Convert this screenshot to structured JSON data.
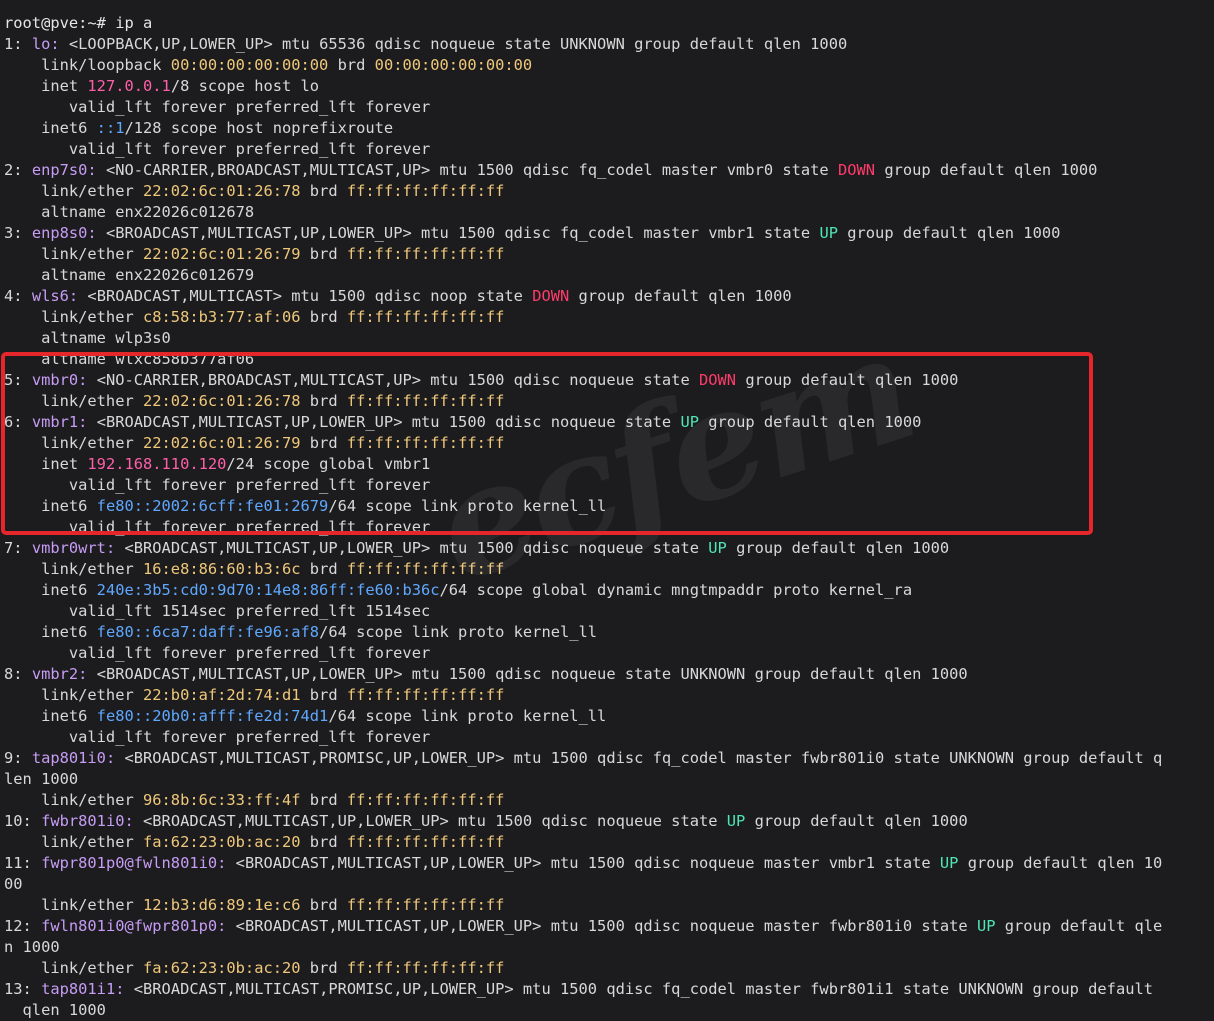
{
  "colors": {
    "background": "#1c1c1e",
    "text": "#d8d8d8",
    "interface": "#c79cf5",
    "mac": "#f0c87a",
    "ipv4": "#ff5fa8",
    "ipv6": "#5fa8ff",
    "state_down": "#ff3b6b",
    "state_up": "#4fe6b5",
    "highlight_box": "#e5262b"
  },
  "watermark": "ecfem",
  "terminal_lines": [
    [
      {
        "t": "                                                                   ",
        "c": "default"
      }
    ],
    [
      {
        "t": "root@pve:~# ip a",
        "c": "prompt"
      }
    ],
    [
      {
        "t": "1: ",
        "c": "default"
      },
      {
        "t": "lo:",
        "c": "iface"
      },
      {
        "t": " <LOOPBACK,UP,LOWER_UP> mtu 65536 qdisc noqueue state UNKNOWN group default qlen 1000",
        "c": "default"
      }
    ],
    [
      {
        "t": "    link/loopback ",
        "c": "default"
      },
      {
        "t": "00:00:00:00:00:00",
        "c": "mac"
      },
      {
        "t": " brd ",
        "c": "default"
      },
      {
        "t": "00:00:00:00:00:00",
        "c": "bcast"
      }
    ],
    [
      {
        "t": "    inet ",
        "c": "default"
      },
      {
        "t": "127.0.0.1",
        "c": "ip4"
      },
      {
        "t": "/8 scope host lo",
        "c": "default"
      }
    ],
    [
      {
        "t": "       valid_lft forever preferred_lft forever",
        "c": "default"
      }
    ],
    [
      {
        "t": "    inet6 ",
        "c": "default"
      },
      {
        "t": "::1",
        "c": "ip6"
      },
      {
        "t": "/128 scope host noprefixroute",
        "c": "default"
      }
    ],
    [
      {
        "t": "       valid_lft forever preferred_lft forever",
        "c": "default"
      }
    ],
    [
      {
        "t": "2: ",
        "c": "default"
      },
      {
        "t": "enp7s0:",
        "c": "iface"
      },
      {
        "t": " <NO-CARRIER,BROADCAST,MULTICAST,UP> mtu 1500 qdisc fq_codel master vmbr0 state ",
        "c": "default"
      },
      {
        "t": "DOWN",
        "c": "down"
      },
      {
        "t": " group default qlen 1000",
        "c": "default"
      }
    ],
    [
      {
        "t": "    link/ether ",
        "c": "default"
      },
      {
        "t": "22:02:6c:01:26:78",
        "c": "mac"
      },
      {
        "t": " brd ",
        "c": "default"
      },
      {
        "t": "ff:ff:ff:ff:ff:ff",
        "c": "bcast"
      }
    ],
    [
      {
        "t": "    altname enx22026c012678",
        "c": "default"
      }
    ],
    [
      {
        "t": "3: ",
        "c": "default"
      },
      {
        "t": "enp8s0:",
        "c": "iface"
      },
      {
        "t": " <BROADCAST,MULTICAST,UP,LOWER_UP> mtu 1500 qdisc fq_codel master vmbr1 state ",
        "c": "default"
      },
      {
        "t": "UP",
        "c": "up"
      },
      {
        "t": " group default qlen 1000",
        "c": "default"
      }
    ],
    [
      {
        "t": "    link/ether ",
        "c": "default"
      },
      {
        "t": "22:02:6c:01:26:79",
        "c": "mac"
      },
      {
        "t": " brd ",
        "c": "default"
      },
      {
        "t": "ff:ff:ff:ff:ff:ff",
        "c": "bcast"
      }
    ],
    [
      {
        "t": "    altname enx22026c012679",
        "c": "default"
      }
    ],
    [
      {
        "t": "4: ",
        "c": "default"
      },
      {
        "t": "wls6:",
        "c": "iface"
      },
      {
        "t": " <BROADCAST,MULTICAST> mtu 1500 qdisc noop state ",
        "c": "default"
      },
      {
        "t": "DOWN",
        "c": "down"
      },
      {
        "t": " group default qlen 1000",
        "c": "default"
      }
    ],
    [
      {
        "t": "    link/ether ",
        "c": "default"
      },
      {
        "t": "c8:58:b3:77:af:06",
        "c": "mac"
      },
      {
        "t": " brd ",
        "c": "default"
      },
      {
        "t": "ff:ff:ff:ff:ff:ff",
        "c": "bcast"
      }
    ],
    [
      {
        "t": "    altname wlp3s0",
        "c": "default"
      }
    ],
    [
      {
        "t": "    altname wlxc858b377af06",
        "c": "default"
      }
    ],
    [
      {
        "t": "5: ",
        "c": "default"
      },
      {
        "t": "vmbr0:",
        "c": "iface"
      },
      {
        "t": " <NO-CARRIER,BROADCAST,MULTICAST,UP> mtu 1500 qdisc noqueue state ",
        "c": "default"
      },
      {
        "t": "DOWN",
        "c": "down"
      },
      {
        "t": " group default qlen 1000",
        "c": "default"
      }
    ],
    [
      {
        "t": "    link/ether ",
        "c": "default"
      },
      {
        "t": "22:02:6c:01:26:78",
        "c": "mac"
      },
      {
        "t": " brd ",
        "c": "default"
      },
      {
        "t": "ff:ff:ff:ff:ff:ff",
        "c": "bcast"
      }
    ],
    [
      {
        "t": "6: ",
        "c": "default"
      },
      {
        "t": "vmbr1:",
        "c": "iface"
      },
      {
        "t": " <BROADCAST,MULTICAST,UP,LOWER_UP> mtu 1500 qdisc noqueue state ",
        "c": "default"
      },
      {
        "t": "UP",
        "c": "up"
      },
      {
        "t": " group default qlen 1000",
        "c": "default"
      }
    ],
    [
      {
        "t": "    link/ether ",
        "c": "default"
      },
      {
        "t": "22:02:6c:01:26:79",
        "c": "mac"
      },
      {
        "t": " brd ",
        "c": "default"
      },
      {
        "t": "ff:ff:ff:ff:ff:ff",
        "c": "bcast"
      }
    ],
    [
      {
        "t": "    inet ",
        "c": "default"
      },
      {
        "t": "192.168.110.120",
        "c": "ip4"
      },
      {
        "t": "/24 scope global vmbr1",
        "c": "default"
      }
    ],
    [
      {
        "t": "       valid_lft forever preferred_lft forever",
        "c": "default"
      }
    ],
    [
      {
        "t": "    inet6 ",
        "c": "default"
      },
      {
        "t": "fe80::2002:6cff:fe01:2679",
        "c": "ip6"
      },
      {
        "t": "/64 scope link proto kernel_ll",
        "c": "default"
      }
    ],
    [
      {
        "t": "       valid_lft forever preferred_lft forever",
        "c": "default"
      }
    ],
    [
      {
        "t": "7: ",
        "c": "default"
      },
      {
        "t": "vmbr0wrt:",
        "c": "iface"
      },
      {
        "t": " <BROADCAST,MULTICAST,UP,LOWER_UP> mtu 1500 qdisc noqueue state ",
        "c": "default"
      },
      {
        "t": "UP",
        "c": "up"
      },
      {
        "t": " group default qlen 1000",
        "c": "default"
      }
    ],
    [
      {
        "t": "    link/ether ",
        "c": "default"
      },
      {
        "t": "16:e8:86:60:b3:6c",
        "c": "mac"
      },
      {
        "t": " brd ",
        "c": "default"
      },
      {
        "t": "ff:ff:ff:ff:ff:ff",
        "c": "bcast"
      }
    ],
    [
      {
        "t": "    inet6 ",
        "c": "default"
      },
      {
        "t": "240e:3b5:cd0:9d70:14e8:86ff:fe60:b36c",
        "c": "ip6"
      },
      {
        "t": "/64 scope global dynamic mngtmpaddr proto kernel_ra",
        "c": "default"
      }
    ],
    [
      {
        "t": "       valid_lft 1514sec preferred_lft 1514sec",
        "c": "default"
      }
    ],
    [
      {
        "t": "    inet6 ",
        "c": "default"
      },
      {
        "t": "fe80::6ca7:daff:fe96:af8",
        "c": "ip6"
      },
      {
        "t": "/64 scope link proto kernel_ll",
        "c": "default"
      }
    ],
    [
      {
        "t": "       valid_lft forever preferred_lft forever",
        "c": "default"
      }
    ],
    [
      {
        "t": "8: ",
        "c": "default"
      },
      {
        "t": "vmbr2:",
        "c": "iface"
      },
      {
        "t": " <BROADCAST,MULTICAST,UP,LOWER_UP> mtu 1500 qdisc noqueue state UNKNOWN group default qlen 1000",
        "c": "default"
      }
    ],
    [
      {
        "t": "    link/ether ",
        "c": "default"
      },
      {
        "t": "22:b0:af:2d:74:d1",
        "c": "mac"
      },
      {
        "t": " brd ",
        "c": "default"
      },
      {
        "t": "ff:ff:ff:ff:ff:ff",
        "c": "bcast"
      }
    ],
    [
      {
        "t": "    inet6 ",
        "c": "default"
      },
      {
        "t": "fe80::20b0:afff:fe2d:74d1",
        "c": "ip6"
      },
      {
        "t": "/64 scope link proto kernel_ll",
        "c": "default"
      }
    ],
    [
      {
        "t": "       valid_lft forever preferred_lft forever",
        "c": "default"
      }
    ],
    [
      {
        "t": "9: ",
        "c": "default"
      },
      {
        "t": "tap801i0:",
        "c": "iface"
      },
      {
        "t": " <BROADCAST,MULTICAST,PROMISC,UP,LOWER_UP> mtu 1500 qdisc fq_codel master fwbr801i0 state UNKNOWN group default q",
        "c": "default"
      }
    ],
    [
      {
        "t": "len 1000",
        "c": "default"
      }
    ],
    [
      {
        "t": "    link/ether ",
        "c": "default"
      },
      {
        "t": "96:8b:6c:33:ff:4f",
        "c": "mac"
      },
      {
        "t": " brd ",
        "c": "default"
      },
      {
        "t": "ff:ff:ff:ff:ff:ff",
        "c": "bcast"
      }
    ],
    [
      {
        "t": "10: ",
        "c": "default"
      },
      {
        "t": "fwbr801i0:",
        "c": "iface"
      },
      {
        "t": " <BROADCAST,MULTICAST,UP,LOWER_UP> mtu 1500 qdisc noqueue state ",
        "c": "default"
      },
      {
        "t": "UP",
        "c": "up"
      },
      {
        "t": " group default qlen 1000",
        "c": "default"
      }
    ],
    [
      {
        "t": "    link/ether ",
        "c": "default"
      },
      {
        "t": "fa:62:23:0b:ac:20",
        "c": "mac"
      },
      {
        "t": " brd ",
        "c": "default"
      },
      {
        "t": "ff:ff:ff:ff:ff:ff",
        "c": "bcast"
      }
    ],
    [
      {
        "t": "11: ",
        "c": "default"
      },
      {
        "t": "fwpr801p0@fwln801i0:",
        "c": "iface"
      },
      {
        "t": " <BROADCAST,MULTICAST,UP,LOWER_UP> mtu 1500 qdisc noqueue master vmbr1 state ",
        "c": "default"
      },
      {
        "t": "UP",
        "c": "up"
      },
      {
        "t": " group default qlen 10",
        "c": "default"
      }
    ],
    [
      {
        "t": "00",
        "c": "default"
      }
    ],
    [
      {
        "t": "    link/ether ",
        "c": "default"
      },
      {
        "t": "12:b3:d6:89:1e:c6",
        "c": "mac"
      },
      {
        "t": " brd ",
        "c": "default"
      },
      {
        "t": "ff:ff:ff:ff:ff:ff",
        "c": "bcast"
      }
    ],
    [
      {
        "t": "12: ",
        "c": "default"
      },
      {
        "t": "fwln801i0@fwpr801p0:",
        "c": "iface"
      },
      {
        "t": " <BROADCAST,MULTICAST,UP,LOWER_UP> mtu 1500 qdisc noqueue master fwbr801i0 state ",
        "c": "default"
      },
      {
        "t": "UP",
        "c": "up"
      },
      {
        "t": " group default qle",
        "c": "default"
      }
    ],
    [
      {
        "t": "n 1000",
        "c": "default"
      }
    ],
    [
      {
        "t": "    link/ether ",
        "c": "default"
      },
      {
        "t": "fa:62:23:0b:ac:20",
        "c": "mac"
      },
      {
        "t": " brd ",
        "c": "default"
      },
      {
        "t": "ff:ff:ff:ff:ff:ff",
        "c": "bcast"
      }
    ],
    [
      {
        "t": "13: ",
        "c": "default"
      },
      {
        "t": "tap801i1:",
        "c": "iface"
      },
      {
        "t": " <BROADCAST,MULTICAST,PROMISC,UP,LOWER_UP> mtu 1500 qdisc fq_codel master fwbr801i1 state UNKNOWN group default",
        "c": "default"
      }
    ],
    [
      {
        "t": "  qlen 1000",
        "c": "default"
      }
    ]
  ]
}
